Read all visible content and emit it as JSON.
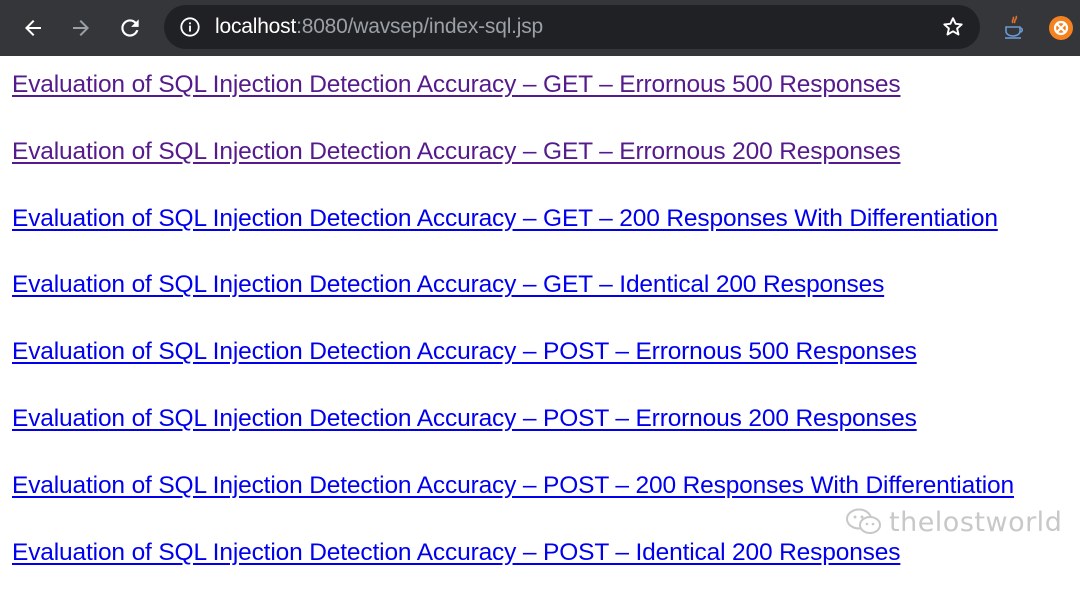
{
  "browser": {
    "url_host": "localhost",
    "url_rest": ":8080/wavsep/index-sql.jsp",
    "toolbar_color": "#35363a",
    "omnibox_color": "#202124"
  },
  "links": [
    {
      "label": "Evaluation of SQL Injection Detection Accuracy – GET – Errornous 500 Responses",
      "visited": true
    },
    {
      "label": "Evaluation of SQL Injection Detection Accuracy – GET – Errornous 200 Responses",
      "visited": true
    },
    {
      "label": "Evaluation of SQL Injection Detection Accuracy – GET – 200 Responses With Differentiation",
      "visited": false
    },
    {
      "label": "Evaluation of SQL Injection Detection Accuracy – GET – Identical 200 Responses",
      "visited": false
    },
    {
      "label": "Evaluation of SQL Injection Detection Accuracy – POST – Errornous 500 Responses",
      "visited": false
    },
    {
      "label": "Evaluation of SQL Injection Detection Accuracy – POST – Errornous 200 Responses",
      "visited": false
    },
    {
      "label": "Evaluation of SQL Injection Detection Accuracy – POST – 200 Responses With Differentiation",
      "visited": false
    },
    {
      "label": "Evaluation of SQL Injection Detection Accuracy – POST – Identical 200 Responses",
      "visited": false
    }
  ],
  "link_colors": {
    "visited": "#551a8b",
    "unvisited": "#0000ee"
  },
  "watermark": {
    "text": "thelostworld"
  }
}
